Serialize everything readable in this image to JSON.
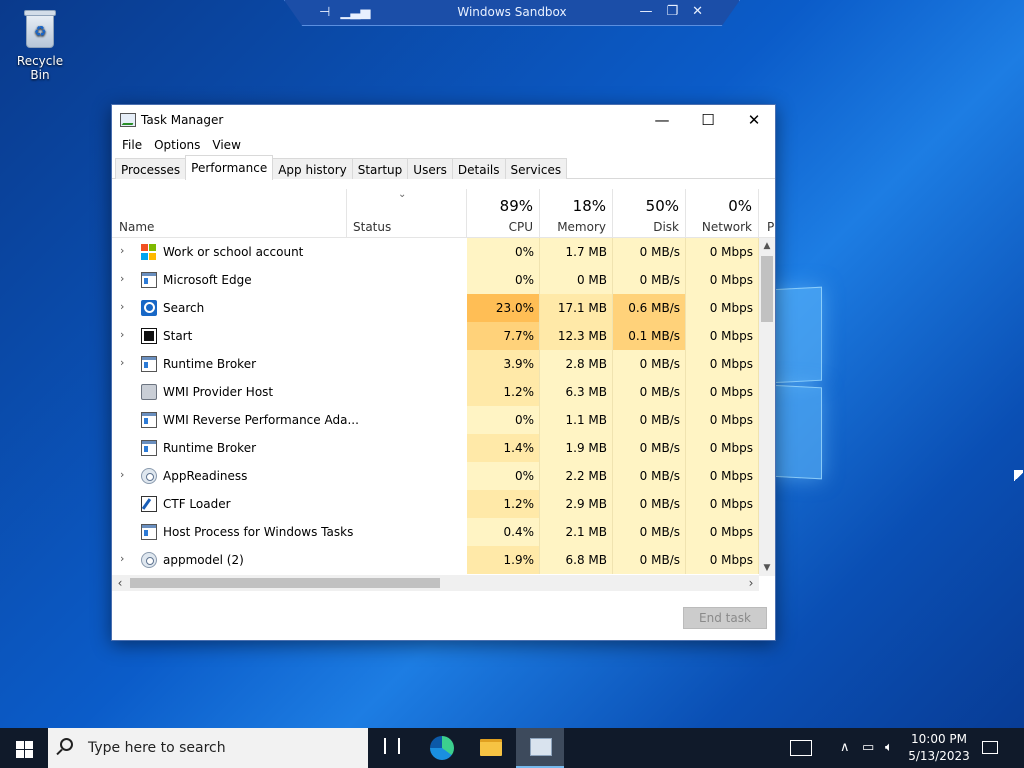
{
  "desktop": {
    "recycle_bin_label": "Recycle Bin"
  },
  "sandbox_bar": {
    "title": "Windows Sandbox"
  },
  "task_manager": {
    "title": "Task Manager",
    "menu": [
      "File",
      "Options",
      "View"
    ],
    "tabs": [
      "Processes",
      "Performance",
      "App history",
      "Startup",
      "Users",
      "Details",
      "Services"
    ],
    "active_tab": "Performance",
    "columns": {
      "name": "Name",
      "status": "Status",
      "cpu": {
        "pct": "89%",
        "label": "CPU"
      },
      "memory": {
        "pct": "18%",
        "label": "Memory"
      },
      "disk": {
        "pct": "50%",
        "label": "Disk"
      },
      "network": {
        "pct": "0%",
        "label": "Network"
      },
      "cut_col_label": "P"
    },
    "rows": [
      {
        "name": "Work or school account",
        "expandable": true,
        "icon": "microsoft-logo-icon",
        "cpu": "0%",
        "memory": "1.7 MB",
        "disk": "0 MB/s",
        "network": "0 Mbps"
      },
      {
        "name": "Microsoft Edge",
        "expandable": true,
        "icon": "app-window-icon",
        "cpu": "0%",
        "memory": "0 MB",
        "disk": "0 MB/s",
        "network": "0 Mbps"
      },
      {
        "name": "Search",
        "expandable": true,
        "icon": "search-icon",
        "cpu": "23.0%",
        "memory": "17.1 MB",
        "disk": "0.6 MB/s",
        "network": "0 Mbps"
      },
      {
        "name": "Start",
        "expandable": true,
        "icon": "start-icon",
        "cpu": "7.7%",
        "memory": "12.3 MB",
        "disk": "0.1 MB/s",
        "network": "0 Mbps"
      },
      {
        "name": "Runtime Broker",
        "expandable": true,
        "icon": "app-window-icon",
        "cpu": "3.9%",
        "memory": "2.8 MB",
        "disk": "0 MB/s",
        "network": "0 Mbps"
      },
      {
        "name": "WMI Provider Host",
        "expandable": false,
        "icon": "wmi-icon",
        "cpu": "1.2%",
        "memory": "6.3 MB",
        "disk": "0 MB/s",
        "network": "0 Mbps"
      },
      {
        "name": "WMI Reverse Performance Ada...",
        "expandable": false,
        "icon": "app-window-icon",
        "cpu": "0%",
        "memory": "1.1 MB",
        "disk": "0 MB/s",
        "network": "0 Mbps"
      },
      {
        "name": "Runtime Broker",
        "expandable": false,
        "icon": "app-window-icon",
        "cpu": "1.4%",
        "memory": "1.9 MB",
        "disk": "0 MB/s",
        "network": "0 Mbps"
      },
      {
        "name": "AppReadiness",
        "expandable": true,
        "icon": "gear-icon",
        "cpu": "0%",
        "memory": "2.2 MB",
        "disk": "0 MB/s",
        "network": "0 Mbps"
      },
      {
        "name": "CTF Loader",
        "expandable": false,
        "icon": "ctf-loader-icon",
        "cpu": "1.2%",
        "memory": "2.9 MB",
        "disk": "0 MB/s",
        "network": "0 Mbps"
      },
      {
        "name": "Host Process for Windows Tasks",
        "expandable": false,
        "icon": "app-window-icon",
        "cpu": "0.4%",
        "memory": "2.1 MB",
        "disk": "0 MB/s",
        "network": "0 Mbps"
      },
      {
        "name": "appmodel (2)",
        "expandable": true,
        "icon": "gear-icon",
        "cpu": "1.9%",
        "memory": "6.8 MB",
        "disk": "0 MB/s",
        "network": "0 Mbps"
      }
    ],
    "end_task_label": "End task",
    "colors": {
      "heat_light": "#fff4c4",
      "heat_mid": "#ffe9a8",
      "heat_high": "#ffd27a",
      "heat_hot": "#ffbe55"
    }
  },
  "taskbar": {
    "search_placeholder": "Type here to search",
    "clock_time": "10:00 PM",
    "clock_date": "5/13/2023"
  }
}
